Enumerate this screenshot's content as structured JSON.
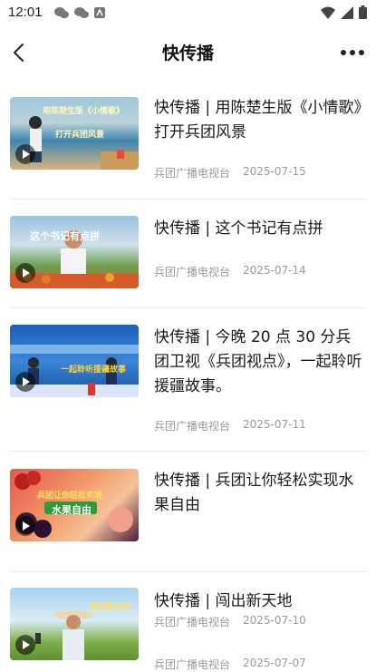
{
  "status_bar": {
    "time": "12:01"
  },
  "header": {
    "title": "快传播"
  },
  "articles": [
    {
      "title": "快传播 | 用陈楚生版《小情歌》打开兵团风景",
      "source": "兵团广播电视台",
      "date": "2025-07-15",
      "thumb_caption": "用陈楚生版《小情歌》"
    },
    {
      "title": "快传播 | 这个书记有点拼",
      "source": "兵团广播电视台",
      "date": "2025-07-14",
      "thumb_caption": "这个书记有点拼"
    },
    {
      "title": "快传播 | 今晚 20 点 30 分兵团卫视《兵团视点》，一起聆听援疆故事。",
      "source": "兵团广播电视台",
      "date": "2025-07-11",
      "thumb_caption": "一起聆听援疆故事"
    },
    {
      "title": "快传播 | 兵团让你轻松实现水果自由",
      "source": "兵团广播电视台",
      "date": "2025-07-10",
      "thumb_caption": "水果自由"
    },
    {
      "title": "快传播 | 闯出新天地",
      "source": "兵团广播电视台",
      "date": "2025-07-07",
      "thumb_caption": "闯出新天地"
    }
  ],
  "colors": {
    "accent_red": "#d93a2b",
    "meta_gray": "#9a9a9a"
  }
}
